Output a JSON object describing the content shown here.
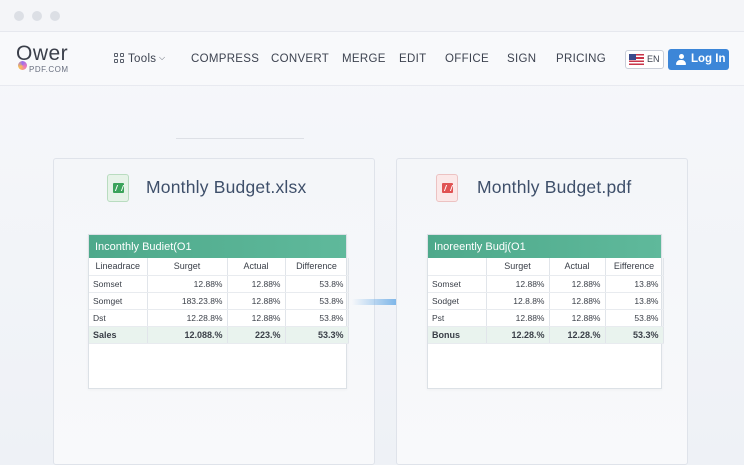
{
  "logo": {
    "main": "Ower",
    "sub": "PDF.COM"
  },
  "nav": {
    "tools": "Tools",
    "items": [
      "COMPRESS",
      "CONVERT",
      "MERGE",
      "EDIT",
      "OFFICE",
      "SIGN",
      "PRICING"
    ],
    "lang": "EN",
    "login": "Log In"
  },
  "source": {
    "filename": "Monthly Budget.xlsx",
    "sheet_title": "Inconthly Budiet(O1",
    "columns": [
      "Lineadrace",
      "Surget",
      "Actual",
      "Difference"
    ],
    "rows": [
      [
        "Somset",
        "12.88%",
        "12.88%",
        "53.8%"
      ],
      [
        "Somget",
        "183.23.8%",
        "12.88%",
        "53.8%"
      ],
      [
        "Dst",
        "12.28.8%",
        "12.88%",
        "53.8%"
      ]
    ],
    "total": [
      "Sales",
      "12.088.%",
      "223.%",
      "53.3%"
    ]
  },
  "target": {
    "filename": "Monthly Budget.pdf",
    "sheet_title": "Inoreently Budj(O1",
    "columns": [
      "",
      "Surget",
      "Actual",
      "Eifference"
    ],
    "rows": [
      [
        "Somset",
        "12.88%",
        "12.88%",
        "13.8%"
      ],
      [
        "Sodget",
        "12.8.8%",
        "12.88%",
        "13.8%"
      ],
      [
        "Pst",
        "12.88%",
        "12.88%",
        "53.8%"
      ]
    ],
    "total": [
      "Bonus",
      "12.28.%",
      "12.28.%",
      "53.3%"
    ]
  },
  "colors": {
    "accent": "#3c86d8",
    "sheet_header": "#4ea98b",
    "excel": "#3aa35a",
    "pdf": "#e05252"
  }
}
